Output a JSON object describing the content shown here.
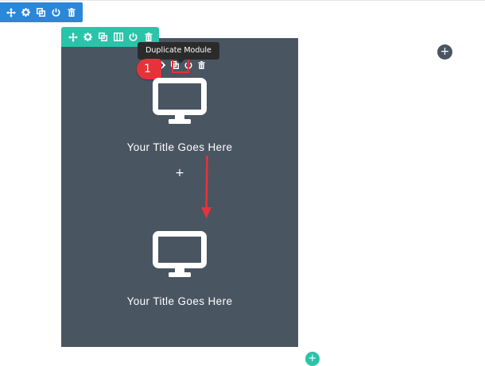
{
  "colors": {
    "section_blue": "#2b87da",
    "row_green": "#29c4a9",
    "column_slate": "#4a5562",
    "callout_red": "#e8323a",
    "tooltip_dark": "#2b2b2b"
  },
  "section_toolbar": {
    "icons": [
      "move-icon",
      "gear-icon",
      "duplicate-icon",
      "power-icon",
      "trash-icon"
    ]
  },
  "row_toolbar": {
    "icons": [
      "move-icon",
      "gear-icon",
      "duplicate-icon",
      "columns-icon",
      "power-icon",
      "trash-icon"
    ]
  },
  "module_toolbar": {
    "icons": [
      "gear-icon",
      "duplicate-icon",
      "power-icon",
      "trash-icon"
    ],
    "highlighted": "duplicate-icon"
  },
  "tooltip": {
    "text": "Duplicate Module"
  },
  "step_badge": {
    "number": "1"
  },
  "modules": [
    {
      "icon": "monitor-icon",
      "title": "Your Title Goes Here"
    },
    {
      "icon": "monitor-icon",
      "title": "Your Title Goes Here"
    }
  ],
  "add_module": {
    "label": "+"
  },
  "add_section": {
    "label": "+"
  },
  "add_row": {
    "label": "+"
  }
}
